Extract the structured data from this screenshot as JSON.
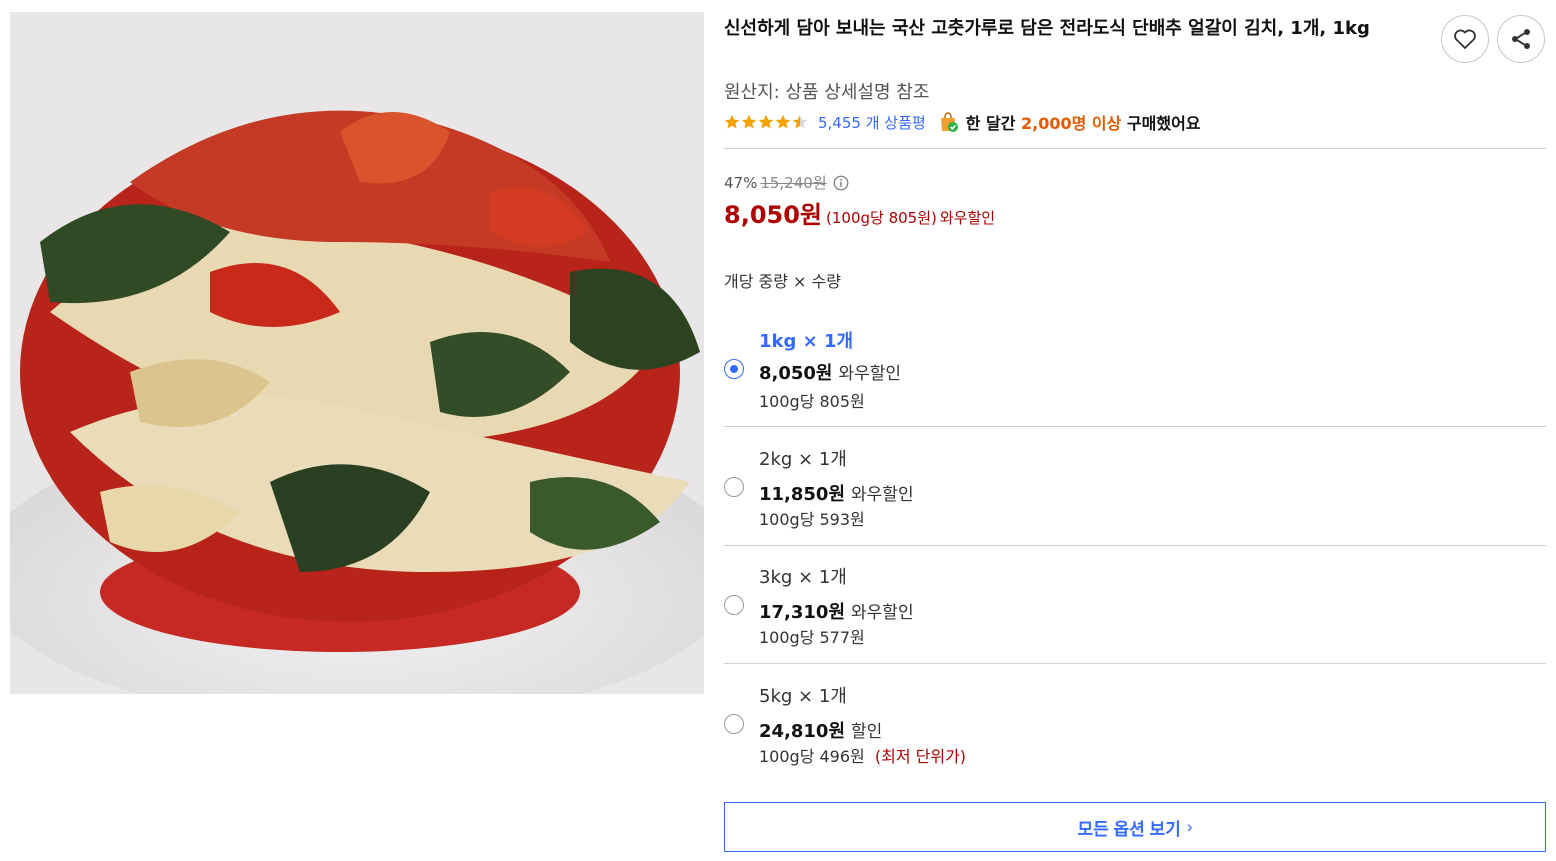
{
  "product": {
    "title": "신선하게 담아 보내는 국산 고춧가루로 담은 전라도식 단배추 얼갈이 김치, 1개, 1kg",
    "origin": "원산지: 상품 상세설명 참조",
    "rating": 4.5,
    "review_count": "5,455 개 상품평",
    "bought_prefix": "한 달간",
    "bought_highlight": "2,000명 이상",
    "bought_suffix": "구매했어요",
    "image_icon": "kimchi-photo"
  },
  "pricing": {
    "discount_rate": "47%",
    "original_price": "15,240원",
    "sale_price": "8,050원",
    "unit_price": "(100g당 805원)",
    "sale_tag": "와우할인"
  },
  "options": {
    "section_label": "개당 중량 × 수량",
    "items": [
      {
        "name": "1kg × 1개",
        "price": "8,050원",
        "tag": "와우할인",
        "unit": "100g당 805원",
        "note": "",
        "selected": true
      },
      {
        "name": "2kg × 1개",
        "price": "11,850원",
        "tag": "와우할인",
        "unit": "100g당 593원",
        "note": "",
        "selected": false
      },
      {
        "name": "3kg × 1개",
        "price": "17,310원",
        "tag": "와우할인",
        "unit": "100g당 577원",
        "note": "",
        "selected": false
      },
      {
        "name": "5kg × 1개",
        "price": "24,810원",
        "tag": "할인",
        "unit": "100g당 496원",
        "note": "(최저 단위가)",
        "selected": false
      }
    ],
    "view_all_label": "모든 옵션 보기"
  },
  "colors": {
    "accent_blue": "#346aff",
    "price_red": "#ae0000",
    "highlight_orange": "#e35b00",
    "star": "#f5a100"
  }
}
